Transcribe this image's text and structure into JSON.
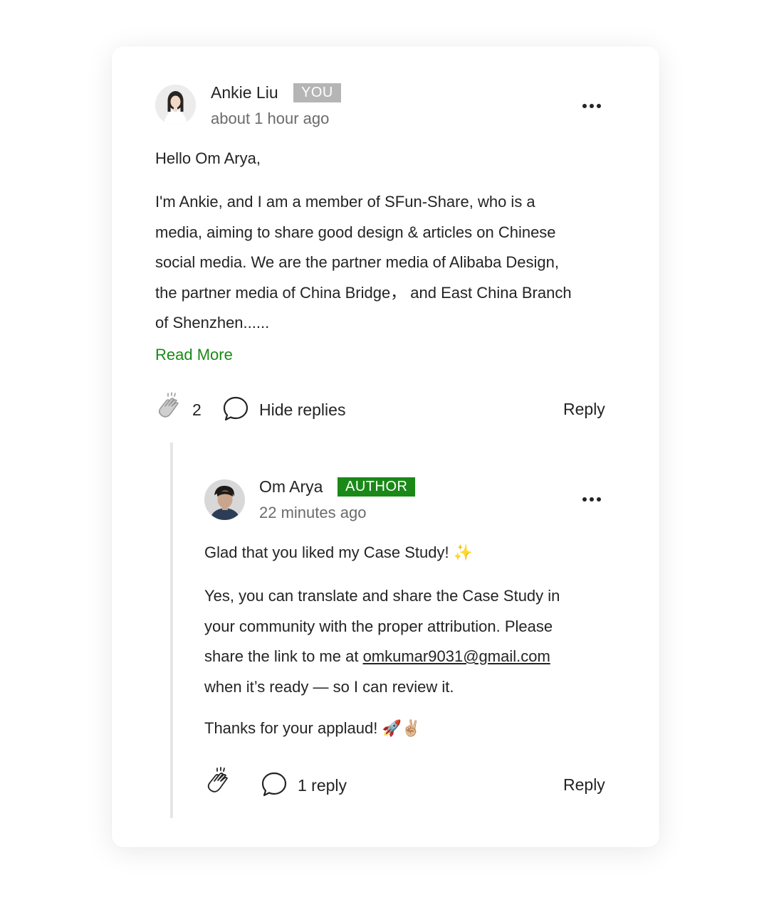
{
  "comment": {
    "author": "Ankie Liu",
    "badge": "YOU",
    "time": "about 1 hour ago",
    "greeting": "Hello Om Arya,",
    "body_lines": [
      "I'm Ankie, and I am a member of SFun-Share, who is a",
      "media, aiming to share good design & articles on Chinese",
      "social media. We are the partner media of Alibaba Design,",
      "the partner media of China Bridge， and East China Branch",
      "of Shenzhen......"
    ],
    "read_more": "Read More",
    "claps": "2",
    "hide_replies": "Hide replies",
    "reply": "Reply"
  },
  "reply": {
    "author": "Om Arya",
    "badge": "AUTHOR",
    "time": "22 minutes ago",
    "line1": "Glad that you liked my Case Study! ✨",
    "para2_line1": "Yes, you can translate and share the Case Study in",
    "para2_line2": "your community with the proper attribution. Please",
    "para2_line3_prefix": "share the link to me at ",
    "email": "omkumar9031@gmail.com",
    "para2_line4": "when it’s ready — so I can review it.",
    "thanks": "Thanks for your applaud! 🚀✌🏼",
    "replies_count": "1 reply",
    "reply": "Reply"
  },
  "colors": {
    "accent_green": "#1a8917",
    "you_badge": "#b5b5b5",
    "thread_line": "#e6e6e6"
  },
  "icons": {
    "clap": "clap-icon",
    "bubble": "speech-bubble-icon",
    "more": "more-horizontal-icon"
  }
}
